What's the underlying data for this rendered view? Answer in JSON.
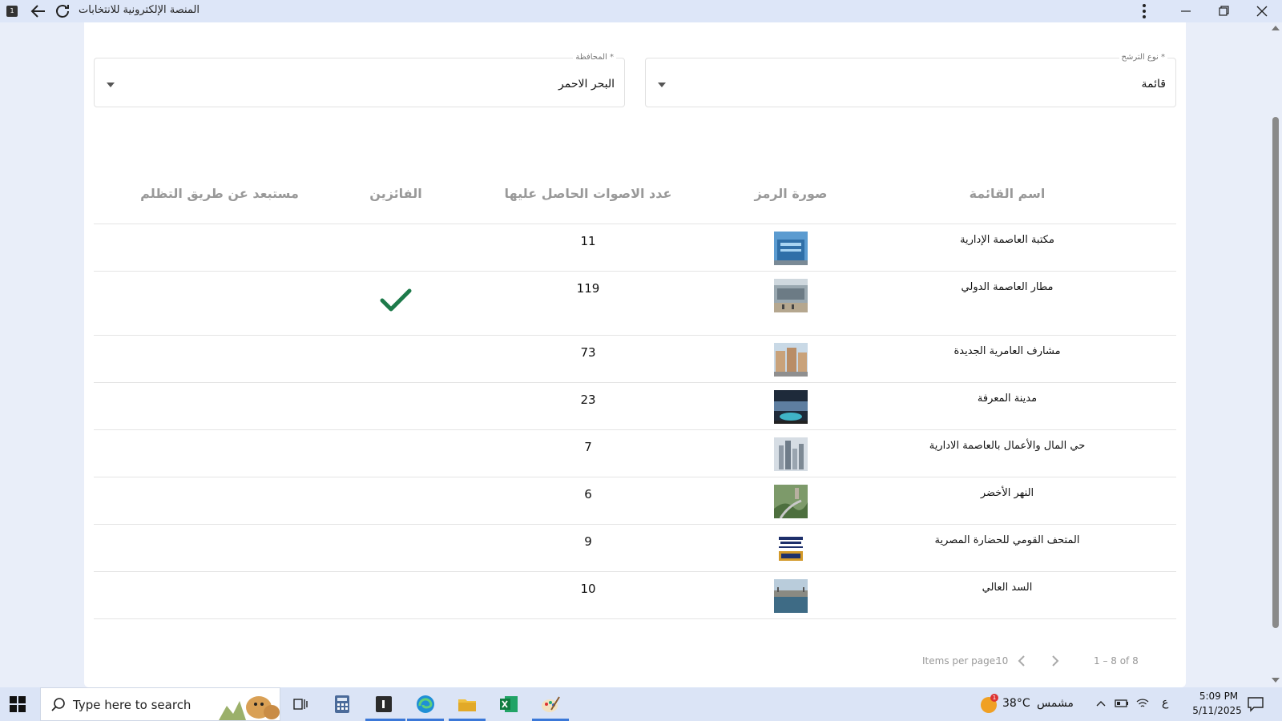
{
  "window": {
    "title": "المنصة الإلكترونية للانتخابات",
    "app_badge": "1"
  },
  "filters": {
    "candidacy_type": {
      "label": "نوع الترشح *",
      "value": "قائمة"
    },
    "governorate": {
      "label": "المحافظة *",
      "value": "البحر الاحمر"
    }
  },
  "table": {
    "headers": {
      "list_name": "اسم القائمة",
      "symbol_image": "صورة الرمز",
      "votes": "عدد الاصوات الحاصل عليها",
      "winners": "الفائزين",
      "excluded": "مستبعد عن طريق التظلم"
    },
    "rows": [
      {
        "name": "مكتبة العاصمة الإدارية",
        "votes": "11",
        "winner": false,
        "image": "tower-blue"
      },
      {
        "name": "مطار العاصمة الدولي",
        "votes": "119",
        "winner": true,
        "image": "airport"
      },
      {
        "name": "مشارف العامرية الجديدة",
        "votes": "73",
        "winner": false,
        "image": "buildings"
      },
      {
        "name": "مدينة المعرفة",
        "votes": "23",
        "winner": false,
        "image": "night-campus"
      },
      {
        "name": "حي المال والأعمال بالعاصمة الادارية",
        "votes": "7",
        "winner": false,
        "image": "skyline"
      },
      {
        "name": "النهر الأخضر",
        "votes": "6",
        "winner": false,
        "image": "green-river"
      },
      {
        "name": "المتحف القومي للحضارة المصرية",
        "votes": "9",
        "winner": false,
        "image": "nmec-logo"
      },
      {
        "name": "السد العالي",
        "votes": "10",
        "winner": false,
        "image": "dam"
      }
    ]
  },
  "paginator": {
    "items_per_page_label": "Items per page:",
    "page_size": "10",
    "range": "1 – 8 of 8"
  },
  "taskbar": {
    "search_placeholder": "Type here to search",
    "weather_badge": "1",
    "temperature": "38°C",
    "condition": "مشمس",
    "language": "ع",
    "time": "5:09 PM",
    "date": "5/11/2025"
  },
  "colors": {
    "check": "#1d7a4a",
    "accent": "#3b78d8",
    "page_bg": "#e9eef9"
  }
}
